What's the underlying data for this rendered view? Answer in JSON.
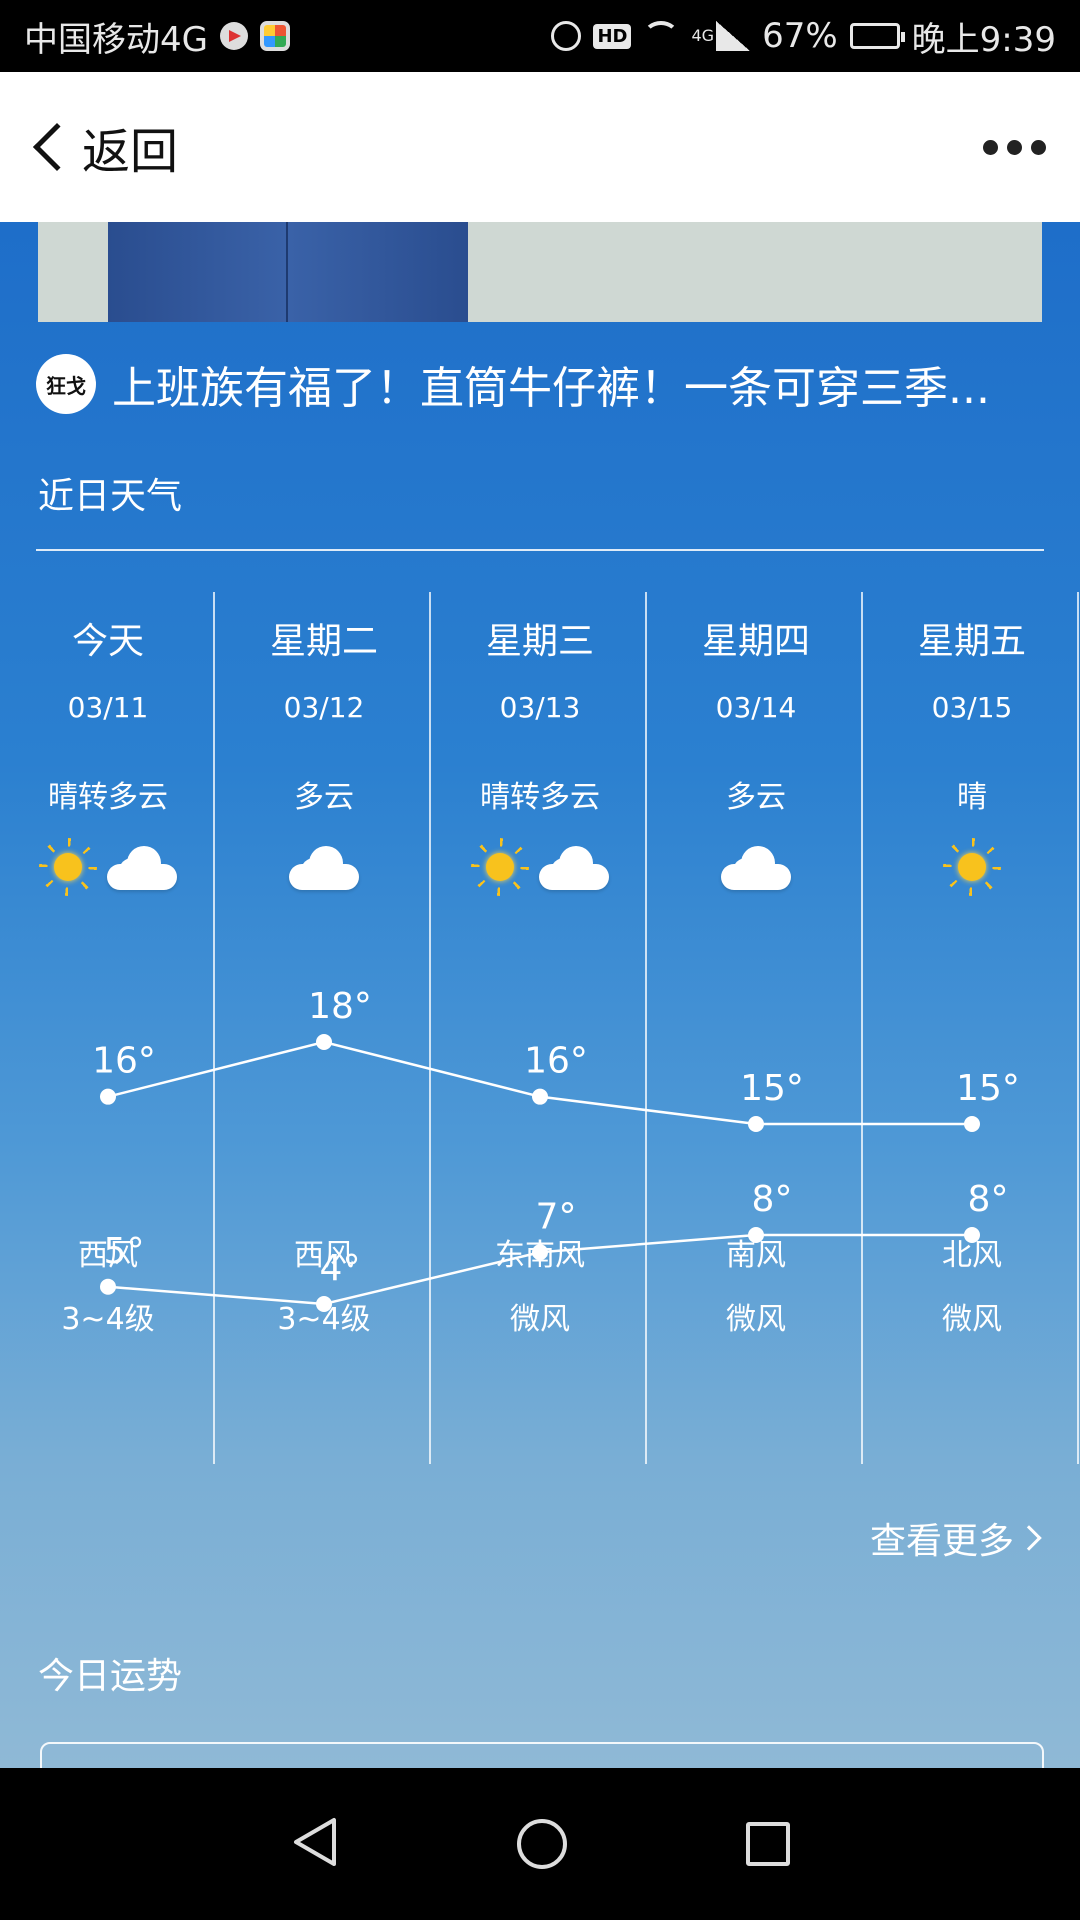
{
  "status_bar": {
    "carrier": "中国移动4G",
    "battery": "67%",
    "time": "晚上9:39",
    "hd": "HD",
    "network": "4G"
  },
  "header": {
    "back_label": "返回"
  },
  "ad": {
    "badge": "狂戈",
    "title": "上班族有福了！直筒牛仔裤！一条可穿三季..."
  },
  "forecast": {
    "section_title": "近日天气",
    "days": [
      {
        "name": "今天",
        "date": "03/11",
        "condition": "晴转多云",
        "icons": [
          "sun-icon",
          "cloud-icon"
        ],
        "high": 16,
        "low": 5,
        "high_label": "16°",
        "low_label": "5°",
        "wind_dir": "西风",
        "wind_level": "3~4级"
      },
      {
        "name": "星期二",
        "date": "03/12",
        "condition": "多云",
        "icons": [
          "cloud-icon"
        ],
        "high": 18,
        "low": 4,
        "high_label": "18°",
        "low_label": "4°",
        "wind_dir": "西风",
        "wind_level": "3~4级"
      },
      {
        "name": "星期三",
        "date": "03/13",
        "condition": "晴转多云",
        "icons": [
          "sun-icon",
          "cloud-icon"
        ],
        "high": 16,
        "low": 7,
        "high_label": "16°",
        "low_label": "7°",
        "wind_dir": "东南风",
        "wind_level": "微风"
      },
      {
        "name": "星期四",
        "date": "03/14",
        "condition": "多云",
        "icons": [
          "cloud-icon"
        ],
        "high": 15,
        "low": 8,
        "high_label": "15°",
        "low_label": "8°",
        "wind_dir": "南风",
        "wind_level": "微风"
      },
      {
        "name": "星期五",
        "date": "03/15",
        "condition": "晴",
        "icons": [
          "sun-icon"
        ],
        "high": 15,
        "low": 8,
        "high_label": "15°",
        "low_label": "8°",
        "wind_dir": "北风",
        "wind_level": "微风"
      }
    ],
    "more_label": "查看更多"
  },
  "fortune": {
    "section_title": "今日运势"
  },
  "chart_data": {
    "type": "line",
    "categories": [
      "今天",
      "星期二",
      "星期三",
      "星期四",
      "星期五"
    ],
    "series": [
      {
        "values": [
          16,
          18,
          16,
          15,
          15
        ]
      },
      {
        "values": [
          5,
          4,
          7,
          8,
          8
        ]
      }
    ]
  }
}
